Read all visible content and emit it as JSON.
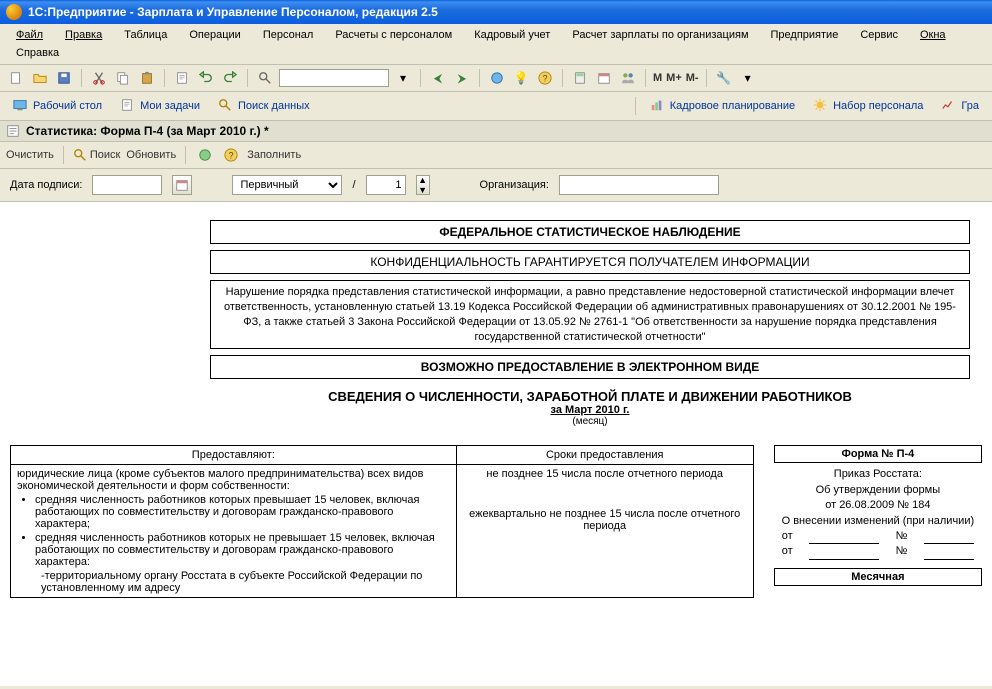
{
  "titlebar": {
    "app_title": "1С:Предприятие - Зарплата и Управление Персоналом, редакция 2.5"
  },
  "menubar": {
    "items": [
      "Файл",
      "Правка",
      "Таблица",
      "Операции",
      "Персонал",
      "Расчеты с персоналом",
      "Кадровый учет",
      "Расчет зарплаты по организациям",
      "Предприятие",
      "Сервис",
      "Окна",
      "Справка"
    ]
  },
  "toolbar1": {
    "m": "M",
    "m_plus": "M+",
    "m_minus": "M-"
  },
  "toolbar2": {
    "desktop": "Рабочий стол",
    "my_tasks": "Мои задачи",
    "search_data": "Поиск данных",
    "hr_planning": "Кадровое планирование",
    "recruitment": "Набор персонала",
    "gra": "Гра"
  },
  "doc": {
    "title": "Статистика: Форма П-4 (за Март 2010 г.) *"
  },
  "doc_toolbar": {
    "clear": "Очистить",
    "search": "Поиск",
    "refresh": "Обновить",
    "fill": "Заполнить"
  },
  "params": {
    "sign_date_label": "Дата подписи:",
    "sign_date_value": "",
    "combo_value": "Первичный",
    "slash": "/",
    "num_value": "1",
    "org_label": "Организация:"
  },
  "report": {
    "header1": "ФЕДЕРАЛЬНОЕ СТАТИСТИЧЕСКОЕ НАБЛЮДЕНИЕ",
    "header2": "КОНФИДЕНЦИАЛЬНОСТЬ ГАРАНТИРУЕТСЯ ПОЛУЧАТЕЛЕМ ИНФОРМАЦИИ",
    "header3": "Нарушение порядка представления статистической информации, а равно представление недостоверной статистической информации влечет ответственность, установленную статьей 13.19 Кодекса Российской Федерации об административных правонарушениях от 30.12.2001 № 195-ФЗ, а также статьей 3 Закона Российской Федерации от 13.05.92 № 2761-1 \"Об ответственности за нарушение порядка представления государственной статистической отчетности\"",
    "header4": "ВОЗМОЖНО ПРЕДОСТАВЛЕНИЕ В ЭЛЕКТРОННОМ ВИДЕ",
    "main_title": "СВЕДЕНИЯ О ЧИСЛЕННОСТИ, ЗАРАБОТНОЙ ПЛАТЕ И ДВИЖЕНИИ РАБОТНИКОВ",
    "sub_title": "за Март 2010 г.",
    "hint": "(месяц)",
    "table": {
      "col1_header": "Предоставляют:",
      "col2_header": "Сроки предоставления",
      "col1_p1": "юридические лица (кроме субъектов малого предпринимательства) всех видов экономической деятельности и форм собственности:",
      "col1_li1": "средняя численность работников которых превышает 15 человек, включая работающих по совместительству и договорам гражданско-правового характера;",
      "col1_li2": "средняя численность работников которых не превышает 15 человек, включая работающих по совместительству и договорам гражданско-правового характера:",
      "col1_sub": "-территориальному органу Росстата в субъекте Российской Федерации по установленному им адресу",
      "col2_p1": "не позднее 15 числа после отчетного периода",
      "col2_p2": "ежеквартально не позднее 15 числа после отчетного периода"
    },
    "form_card": {
      "header": "Форма № П-4",
      "l1": "Приказ Росстата:",
      "l2": "Об утверждении формы",
      "l3": "от 26.08.2009 № 184",
      "l4": "О внесении изменений (при наличии)",
      "from_label": "от",
      "num_label": "№",
      "monthly": "Месячная"
    }
  }
}
